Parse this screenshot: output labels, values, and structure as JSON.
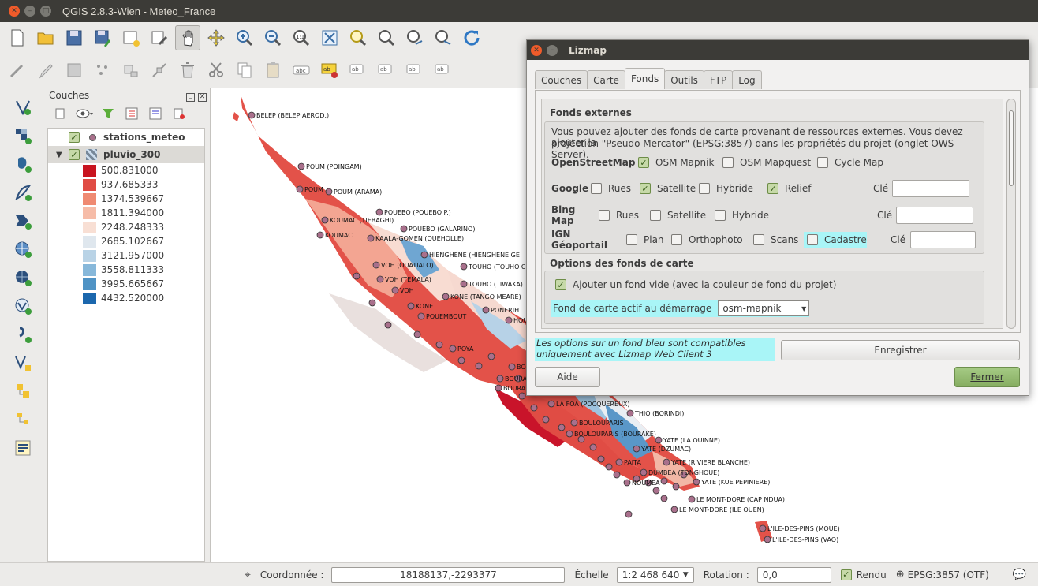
{
  "window": {
    "title": "QGIS 2.8.3-Wien - Meteo_France"
  },
  "layers_panel": {
    "title": "Couches",
    "layers": [
      {
        "name": "stations_meteo",
        "checked": true
      },
      {
        "name": "pluvio_300",
        "checked": true
      }
    ],
    "legend": [
      {
        "value": "500.831000",
        "color": "#c8141f"
      },
      {
        "value": "937.685333",
        "color": "#e04c44"
      },
      {
        "value": "1374.539667",
        "color": "#ef8a72"
      },
      {
        "value": "1811.394000",
        "color": "#f6bca8"
      },
      {
        "value": "2248.248333",
        "color": "#f8dfd4"
      },
      {
        "value": "2685.102667",
        "color": "#dfe7ee"
      },
      {
        "value": "3121.957000",
        "color": "#b9d3e6"
      },
      {
        "value": "3558.811333",
        "color": "#87b8da"
      },
      {
        "value": "3995.665667",
        "color": "#4f93c5"
      },
      {
        "value": "4432.520000",
        "color": "#1b67ad"
      }
    ]
  },
  "map": {
    "labels": [
      "BELEP (BELEP AEROD.)",
      "POUM (POINGAM)",
      "POUM",
      "POUM (ARAMA)",
      "POUEBO (POUEBO P.)",
      "KOUMAC (TIEBAGHI)",
      "POUEBO (GALARINO)",
      "KOUMAC",
      "KAALA-GOMEN (OUEHOLLE)",
      "HIENGHENE (HIENGHENE GE",
      "VOH (OUATIALO)",
      "TOUHO (TOUHO C",
      "VOH (TEMALA)",
      "TOUHO (TIWAKA)",
      "VOH",
      "KONE (TANGO MEARE)",
      "KONE",
      "PONERIH",
      "POUEMBOUT",
      "HOU",
      "POYA",
      "BO",
      "BOURA",
      "BOURA",
      "LA FOA (POCQUEREUX)",
      "THIO (BORINDI)",
      "BOULOUPARIS",
      "BOULOUPARIS (BOURAKE)",
      "YATE (LA OUINNE)",
      "YATE (DZUMAC)",
      "PAITA",
      "YATE (RIVIERE BLANCHE)",
      "DUMBEA (TONGHOUE)",
      "NOUMEA",
      "YATE (KUE PEPINIERE)",
      "LE MONT-DORE (CAP NDUA)",
      "LE MONT-DORE (ILE OUEN)",
      "L'ILE-DES-PINS (MOUE)",
      "L'ILE-DES-PINS (VAO)"
    ]
  },
  "status_bar": {
    "coord_label": "Coordonnée :",
    "coord_value": "18188137,-2293377",
    "scale_label": "Échelle",
    "scale_value": "1:2 468 640",
    "rotation_label": "Rotation :",
    "rotation_value": "0,0",
    "render_label": "Rendu",
    "crs": "EPSG:3857 (OTF)"
  },
  "lizmap": {
    "title": "Lizmap",
    "tabs": [
      "Couches",
      "Carte",
      "Fonds",
      "Outils",
      "FTP",
      "Log"
    ],
    "active_tab": "Fonds",
    "external": {
      "title": "Fonds externes",
      "description_line1": "Vous pouvez ajouter des fonds de carte provenant de ressources externes. Vous devez ajouter la",
      "description_line2": "projection \"Pseudo Mercator\" (EPSG:3857) dans les propriétés du projet (onglet OWS Server).",
      "osm": {
        "label": "OpenStreetMap",
        "mapnik": "OSM Mapnik",
        "mapquest": "OSM Mapquest",
        "cycle": "Cycle Map"
      },
      "google": {
        "label": "Google",
        "rues": "Rues",
        "satellite": "Satellite",
        "hybride": "Hybride",
        "relief": "Relief",
        "key_label": "Clé"
      },
      "bing": {
        "label": "Bing Map",
        "rues": "Rues",
        "satellite": "Satellite",
        "hybride": "Hybride",
        "key_label": "Clé"
      },
      "ign": {
        "label": "IGN Géoportail",
        "plan": "Plan",
        "ortho": "Orthophoto",
        "scans": "Scans",
        "cadastre": "Cadastre",
        "key_label": "Clé"
      }
    },
    "options": {
      "title": "Options des fonds de carte",
      "empty_bg": "Ajouter un fond vide (avec la couleur de fond du projet)",
      "startup_label": "Fond de carte actif au démarrage",
      "startup_value": "osm-mapnik"
    },
    "note_line1": "Les options sur un fond bleu sont compatibles",
    "note_line2": "uniquement avec Lizmap Web Client 3",
    "save": "Enregistrer",
    "help": "Aide",
    "close": "Fermer"
  }
}
